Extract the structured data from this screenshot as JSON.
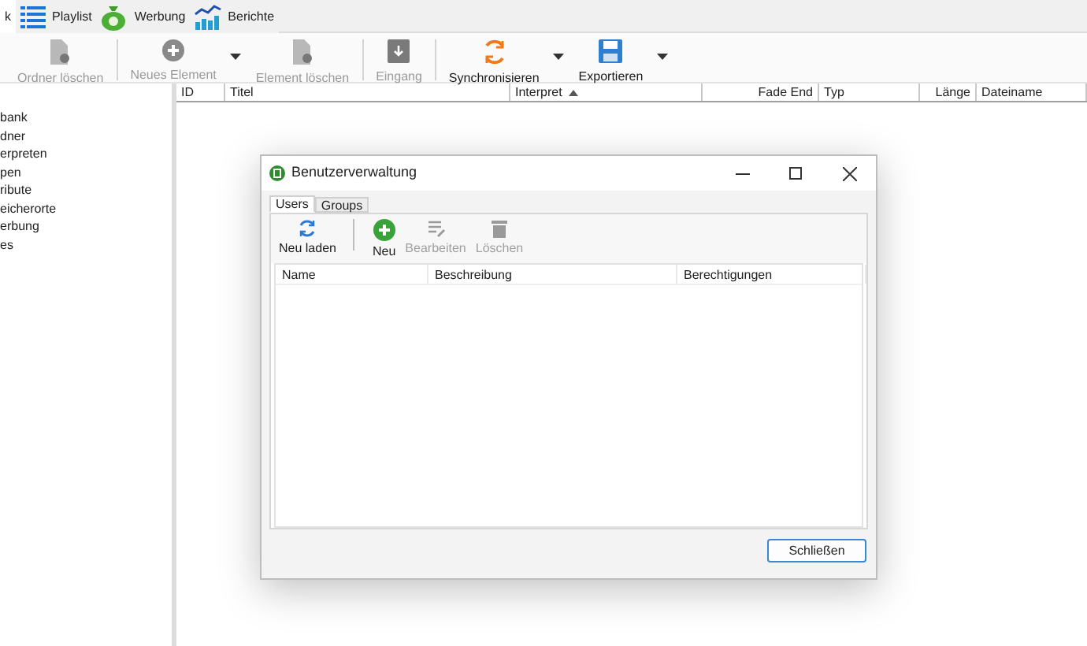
{
  "tabs": [
    {
      "label": "k",
      "kind": "plain",
      "selected": true
    },
    {
      "label": "Playlist",
      "kind": "list",
      "selected": false
    },
    {
      "label": "Werbung",
      "kind": "money",
      "selected": false
    },
    {
      "label": "Berichte",
      "kind": "chart",
      "selected": false
    }
  ],
  "toolbar": [
    {
      "label": "Ordner löschen",
      "kind": "doc",
      "disabled": true,
      "dropdown": false
    },
    {
      "label": "Neues Element",
      "kind": "plus",
      "disabled": true,
      "dropdown": true
    },
    {
      "label": "Element löschen",
      "kind": "doc",
      "disabled": true,
      "dropdown": false
    },
    {
      "label": "Eingang",
      "kind": "inbox",
      "disabled": true,
      "dropdown": false
    },
    {
      "label": "Synchronisieren",
      "kind": "sync",
      "disabled": false,
      "dropdown": true
    },
    {
      "label": "Exportieren",
      "kind": "save",
      "disabled": false,
      "dropdown": true
    }
  ],
  "sidebar": {
    "items": [
      "bank",
      "dner",
      "erpreten",
      "pen",
      "ribute",
      "eicherorte",
      "erbung",
      "es"
    ]
  },
  "table": {
    "columns": [
      {
        "label": "ID",
        "sorted": false
      },
      {
        "label": "Titel",
        "sorted": false
      },
      {
        "label": "Interpret",
        "sorted": true
      },
      {
        "label": "Fade End",
        "sorted": false
      },
      {
        "label": "Typ",
        "sorted": false
      },
      {
        "label": "Länge",
        "sorted": false
      },
      {
        "label": "Dateiname",
        "sorted": false
      }
    ]
  },
  "dialog": {
    "title": "Benutzerverwaltung",
    "tabs": [
      {
        "label": "Users",
        "selected": true
      },
      {
        "label": "Groups",
        "selected": false
      }
    ],
    "toolbar": [
      {
        "label": "Neu laden",
        "kind": "reload",
        "disabled": false
      },
      {
        "label": "Neu",
        "kind": "plus",
        "disabled": false
      },
      {
        "label": "Bearbeiten",
        "kind": "edit",
        "disabled": true
      },
      {
        "label": "Löschen",
        "kind": "trash",
        "disabled": true
      }
    ],
    "columns": [
      "Name",
      "Beschreibung",
      "Berechtigungen"
    ],
    "close_button": "Schließen"
  }
}
